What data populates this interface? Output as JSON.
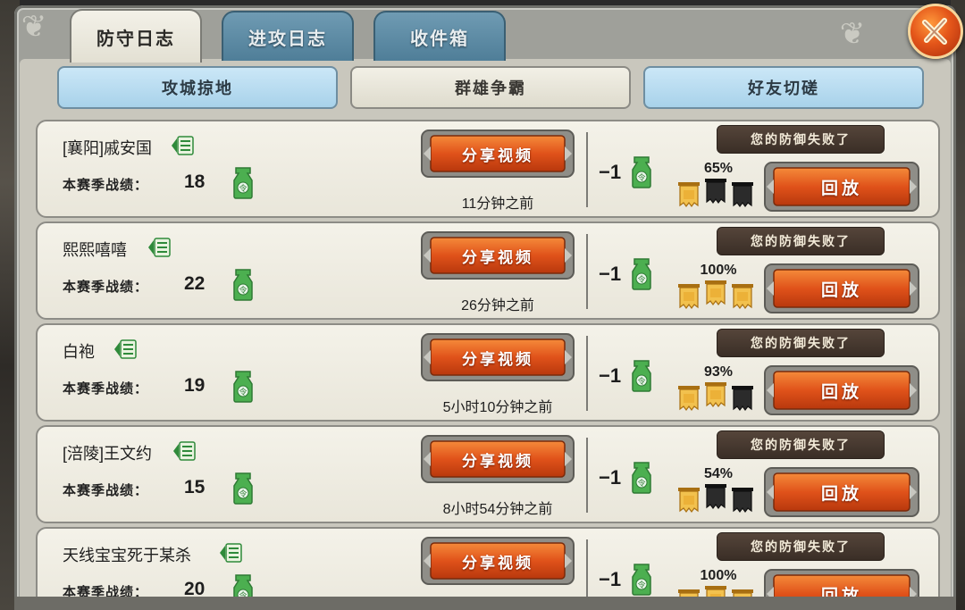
{
  "tabs": [
    {
      "label": "防守日志",
      "active": true
    },
    {
      "label": "进攻日志",
      "active": false
    },
    {
      "label": "收件箱",
      "active": false
    }
  ],
  "subtabs": [
    {
      "label": "攻城掠地",
      "selected": false
    },
    {
      "label": "群雄争霸",
      "selected": true
    },
    {
      "label": "好友切磋",
      "selected": false
    }
  ],
  "labels": {
    "season": "本赛季战绩：",
    "share": "分享视频",
    "replay": "回放",
    "fail": "您的防御失败了",
    "delta": "−1"
  },
  "icons": {
    "close": "close-x-icon",
    "list": "list-icon",
    "token": "green-token-icon",
    "banner_gold": "gold-banner-icon",
    "banner_dark": "dark-banner-icon"
  },
  "colors": {
    "accent_orange": "#e4561a",
    "tab_blue": "#5f8ca6",
    "row_bg": "#f2f0e6"
  },
  "rows": [
    {
      "name": "[襄阳]戚安国",
      "score": "18",
      "time": "11分钟之前",
      "percent": "65%",
      "stars": [
        1,
        0,
        0
      ]
    },
    {
      "name": "熙熙嘻嘻",
      "score": "22",
      "time": "26分钟之前",
      "percent": "100%",
      "stars": [
        1,
        1,
        1
      ]
    },
    {
      "name": "白袍",
      "score": "19",
      "time": "5小时10分钟之前",
      "percent": "93%",
      "stars": [
        1,
        1,
        0
      ]
    },
    {
      "name": "[涪陵]王文约",
      "score": "15",
      "time": "8小时54分钟之前",
      "percent": "54%",
      "stars": [
        1,
        0,
        0
      ]
    },
    {
      "name": "天线宝宝死于某杀",
      "score": "20",
      "time": "",
      "percent": "100%",
      "stars": [
        1,
        1,
        1
      ]
    }
  ]
}
